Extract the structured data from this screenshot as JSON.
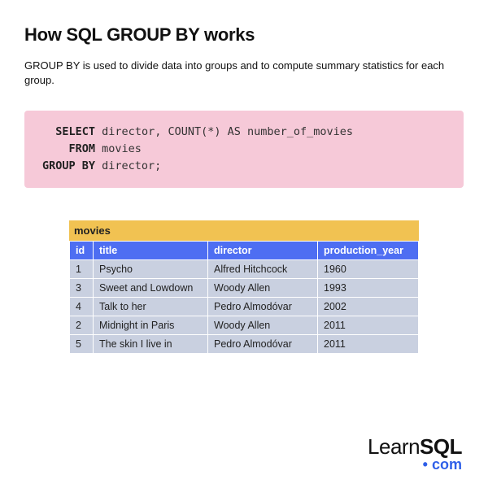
{
  "heading": "How SQL GROUP BY works",
  "description": "GROUP BY is used to divide data into groups and to compute summary statistics for each group.",
  "code": {
    "kw_select": "SELECT",
    "select_rest": " director, COUNT(*) AS number_of_movies",
    "kw_from": "FROM",
    "from_rest": " movies",
    "kw_groupby": "GROUP BY",
    "groupby_rest": " director;"
  },
  "table": {
    "name": "movies",
    "headers": {
      "id": "id",
      "title": "title",
      "director": "director",
      "year": "production_year"
    },
    "rows": [
      {
        "id": "1",
        "title": "Psycho",
        "director": "Alfred Hitchcock",
        "year": "1960"
      },
      {
        "id": "3",
        "title": "Sweet and Lowdown",
        "director": "Woody Allen",
        "year": "1993"
      },
      {
        "id": "4",
        "title": "Talk to her",
        "director": "Pedro Almodóvar",
        "year": "2002"
      },
      {
        "id": "2",
        "title": "Midnight in Paris",
        "director": "Woody Allen",
        "year": "2011"
      },
      {
        "id": "5",
        "title": "The skin I live in",
        "director": "Pedro Almodóvar",
        "year": "2011"
      }
    ]
  },
  "logo": {
    "learn": "Learn",
    "sql": "SQL",
    "com": "com"
  }
}
